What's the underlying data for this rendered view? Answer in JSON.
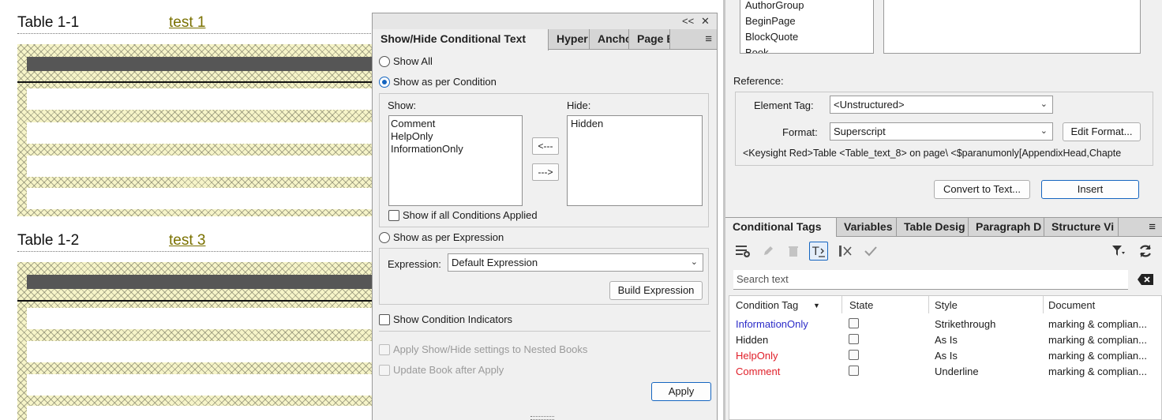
{
  "document": {
    "tables": [
      {
        "title": "Table 1-1",
        "link": "test 1"
      },
      {
        "title": "Table 1-2",
        "link": "test 3"
      }
    ]
  },
  "dialog": {
    "controls": {
      "collapse": "<<",
      "close": "✕"
    },
    "tabs": [
      "Show/Hide Conditional Text",
      "Hyper",
      "Ancho",
      "Page E"
    ],
    "menu_icon": "≡",
    "show_all": "Show All",
    "show_per_condition": "Show as per Condition",
    "show_label": "Show:",
    "hide_label": "Hide:",
    "show_list": [
      "Comment",
      "HelpOnly",
      "InformationOnly"
    ],
    "hide_list": [
      "Hidden"
    ],
    "move_left": "<---",
    "move_right": "--->",
    "show_if_all": "Show if all Conditions Applied",
    "show_per_expression": "Show as per Expression",
    "expression_label": "Expression:",
    "expression_value": "Default Expression",
    "build_expression": "Build Expression",
    "show_indicators": "Show Condition Indicators",
    "apply_nested": "Apply Show/Hide settings to Nested Books",
    "update_book": "Update Book after Apply",
    "apply": "Apply"
  },
  "right": {
    "element_list": [
      "AuthorGroup",
      "BeginPage",
      "BlockQuote",
      "Book"
    ],
    "reference_label": "Reference:",
    "element_tag_label": "Element Tag:",
    "element_tag_value": "<Unstructured>",
    "format_label": "Format:",
    "format_value": "Superscript",
    "edit_format": "Edit Format...",
    "reference_text": "<Keysight Red>Table <Table_text_8> on page\\ <$paranumonly[AppendixHead,Chapte",
    "convert_to_text": "Convert to Text...",
    "insert": "Insert",
    "tabs": [
      "Conditional Tags",
      "Variables",
      "Table Desig",
      "Paragraph D",
      "Structure Vi"
    ],
    "search_placeholder": "Search text",
    "columns": [
      "Condition Tag",
      "State",
      "Style",
      "Document"
    ],
    "rows": [
      {
        "tag": "InformationOnly",
        "color": "#2b2bc8",
        "style": "Strikethrough",
        "document": "marking & complian..."
      },
      {
        "tag": "Hidden",
        "color": "#1a1a1a",
        "style": "As Is",
        "document": "marking & complian..."
      },
      {
        "tag": "HelpOnly",
        "color": "#e0202a",
        "style": "As Is",
        "document": "marking & complian..."
      },
      {
        "tag": "Comment",
        "color": "#e0202a",
        "style": "Underline",
        "document": "marking & complian..."
      }
    ]
  }
}
